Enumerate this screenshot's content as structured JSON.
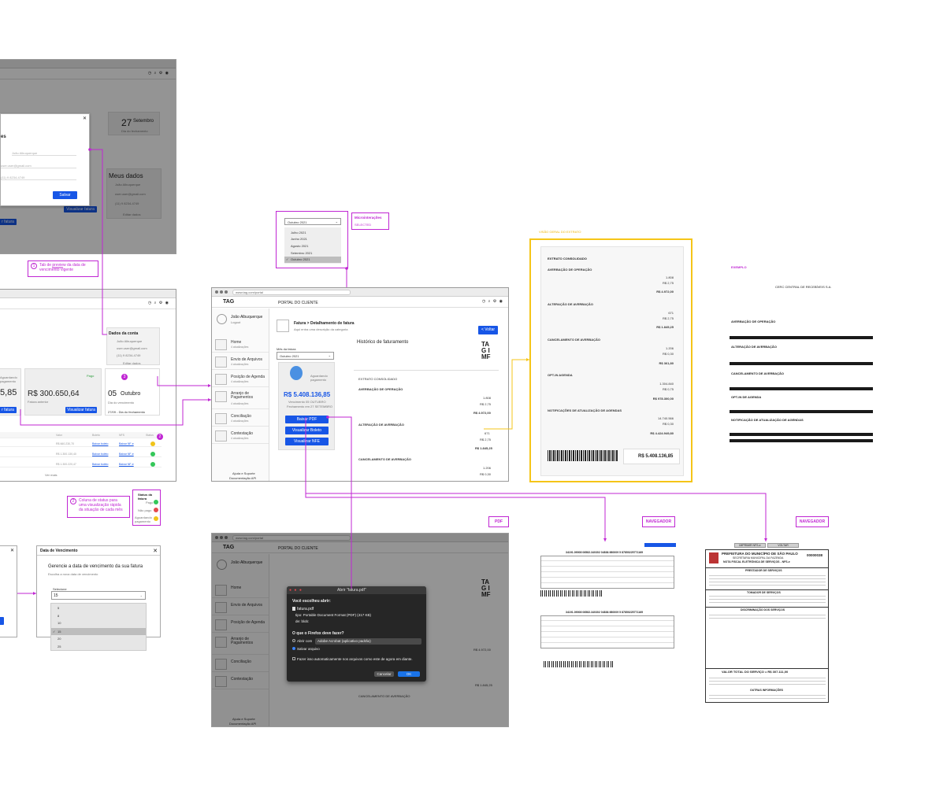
{
  "browser": {
    "url": "www.tag.com/portal"
  },
  "portal": {
    "header_title": "PORTAL DO CLIENTE",
    "user_name": "João Albuquerque",
    "user_action": "Logout",
    "nav": [
      {
        "label": "Home",
        "count": "4 atualizações"
      },
      {
        "label": "Envio de Arquivos",
        "count": "4 atualizações"
      },
      {
        "label": "Posição de Agenda",
        "count": "4 atualizações"
      },
      {
        "label": "Arranjo de Pagamentos",
        "count": "4 atualizações"
      },
      {
        "label": "Conciliação",
        "count": "4 atualizações"
      },
      {
        "label": "Contestação",
        "count": "4 atualizações"
      }
    ],
    "footer": [
      "Ajuda e Suporte",
      "Documentação API"
    ],
    "page_title": "Fatura > Detalhamento de fatura",
    "page_subtitle": "Aqui entra uma descrição da categoria",
    "back_button": "< Voltar",
    "month_label": "Mês da fatura",
    "month_value": "Outubro 2021",
    "status_badge": "Aguardando pagamento",
    "amount": "R$ 5.408.136,85",
    "due_text": "Vencimento 05 OUTUBRO",
    "due_sub": "Fechamento em 27 SETEMBRO",
    "actions": [
      "Baixar PDF",
      "Visualizar Boleto",
      "Visualizar NFE"
    ],
    "history_title": "Histórico de faturamento",
    "logo_text": "TAG IMF",
    "extrato_title": "EXTRATO CONSOLIDADO",
    "sections": [
      "AVERBAÇÃO DE OPERAÇÃO",
      "ALTERAÇÃO DE AVERBAÇÃO",
      "CANCELAMENTO DE AVERBAÇÃO"
    ],
    "values": [
      "1.808",
      "R$ 2,75",
      "R$ 4.972,00",
      "671",
      "R$ 2,75",
      "R$ 1.845,25",
      "1.206",
      "R$ 0,30"
    ]
  },
  "dropdown_micro": {
    "selected": "Outubro 2021",
    "options": [
      "Julho 2021",
      "Junho 2021",
      "Agosto 2021",
      "Setembro 2021",
      "Outubro 2021"
    ],
    "tag_title": "Microinterações",
    "tag_sub": "SELECTED"
  },
  "left_modal": {
    "close": "✕",
    "title": "es",
    "field1": "João Albuquerque",
    "field2": "user.user@gmail.com",
    "field3": "(11) 9 8234-4749",
    "save": "Salvar",
    "date_day": "27",
    "date_month": "Setembro",
    "date_caption": "Dia do fechamento",
    "meus_dados": "Meus dados",
    "md_name": "João Albuquerque",
    "md_email": "user.user@gmail.com",
    "md_phone": "(11) 9 8234-4749",
    "md_link": "Editar dados",
    "btn_left": "r fatura",
    "btn_right": "Visualizar fatura"
  },
  "notes": {
    "n1_num": "1",
    "n1_text": "Tab de preview da data de vencimento vigente",
    "n2_num": "2",
    "n2_text": "Coluna de status para uma visualização rápida da situação de cada mês"
  },
  "left_home": {
    "amount_left": "5,85",
    "amount_mid": "R$ 300.650,64",
    "mid_caption": "Fatura anterior",
    "paid": "Pago",
    "badge": "3",
    "due_day": "05",
    "due_month": "Outubro",
    "due_caption": "Dia do vencimento",
    "footer_line": "27/09 - Dia do fechamento",
    "btn_left": "r fatura",
    "btn_view": "Visualizar fatura",
    "aguardando": "Aguardando pagamento",
    "dados_title": "Dados da conta",
    "dados_name": "João Albuquerque",
    "dados_email": "user.user@gmail.com",
    "dados_phone": "(11) 9 8234-4749",
    "dados_link": "Editar dados",
    "table_head": [
      "Valor",
      "Boleto",
      "NFS",
      "Status"
    ],
    "table_rows": [
      [
        "R$ 660.230,70",
        "Baixar boleto",
        "Baixar NF-e"
      ],
      [
        "R$ 1.300.130,40",
        "Baixar boleto",
        "Baixar NF-e"
      ],
      [
        "R$ 1.300.220,47",
        "Baixar boleto",
        "Baixar NF-e"
      ]
    ],
    "status_badge_num": "2",
    "see_more": "Ver mais"
  },
  "status_legend": {
    "title": "Status da fatura",
    "items": [
      "Pago",
      "Não pago",
      "Aguardando pagamento"
    ]
  },
  "venc_modal": {
    "title": "Data de Vencimento",
    "close": "✕",
    "heading": "Gerencie a data de vencimento da sua fatura",
    "sub": "Escolha a nova data de vencimento",
    "select_label": "Selecione",
    "select_value": "15",
    "options": [
      "5",
      "8",
      "10",
      "15",
      "20",
      "25"
    ]
  },
  "firefox_dialog": {
    "title": "Abrir \"fatura.pdf\"",
    "intro": "Você escolheu abrir:",
    "file": "fatura.pdf",
    "type": "tipo:  Portable Document Format (PDF) (417 KB)",
    "from": "de:  blob:",
    "question": "O que o Firefox deve fazer?",
    "open_with": "Abrir com",
    "app": "Adobe Acrobat (aplicativo padrão)",
    "save": "Salvar arquivo",
    "auto": "Fazer isso automaticamente nos arquivos como este de agora em diante.",
    "cancel": "Cancelar",
    "ok": "OK"
  },
  "extrato_doc": {
    "label": "VISÃO GERAL DO EXTRATO",
    "title": "EXTRATO CONSOLIDADO",
    "sections": [
      "AVERBAÇÃO DE OPERAÇÃO",
      "ALTERAÇÃO DE AVERBAÇÃO",
      "CANCELAMENTO DE AVERBAÇÃO",
      "OPT-IN AGENDA",
      "NOTIFICAÇÕES DE ATUALIZAÇÃO DE AGENDAS"
    ],
    "values": [
      "1.808",
      "R$ 2,75",
      "R$ 4.972,00",
      "671",
      "R$ 2,75",
      "R$ 1.845,25",
      "1.206",
      "R$ 0,30",
      "R$ 361,80",
      "1.304.840",
      "R$ 0,75",
      "R$ 978.300,00",
      "14.740.566",
      "R$ 0,30",
      "R$ 4.424.949,80"
    ],
    "total": "R$ 5.408.136,85"
  },
  "example": {
    "label": "EXEMPLO",
    "org": "CERC CENTRAL DE RECEBÍVEIS S.A.",
    "sections": [
      "AVERBAÇÃO DE OPERAÇÃO",
      "ALTERAÇÃO DE AVERBAÇÃO",
      "CANCELAMENTO DE AVERBAÇÃO",
      "OPT-IN DE AGENDA",
      "NOTIFICAÇÃO DE ATUALIZAÇÃO DE AGENDAS"
    ]
  },
  "labels": {
    "pdf": "PDF",
    "nav1": "NAVEGADOR",
    "nav2": "NAVEGADOR"
  },
  "nfe": {
    "title": "PREFEITURA DO MUNICÍPIO DE SÃO PAULO",
    "sub": "SECRETARIA MUNICIPAL DA FAZENDA",
    "doc": "NOTA FISCAL ELETRÔNICA DE SERVIÇOS - NFS-e",
    "number": "00000038",
    "prestador": "PRESTADOR DE SERVIÇOS",
    "tomador": "TOMADOR DE SERVIÇOS",
    "discr": "DISCRIMINAÇÃO DOS SERVIÇOS",
    "total": "VALOR TOTAL DO SERVIÇO = R$ 307.111,00",
    "outras": "OUTRAS INFORMAÇÕES",
    "btn1": "IMPRIMIR NFS-e",
    "btn2": "VOLTAR"
  },
  "boleto": {
    "line1": "34191.09008 06582.340302 04836.980009 5 87850225771169",
    "line2": "34191.09008 06582.340302 04836.980009 5 87850225771169"
  }
}
